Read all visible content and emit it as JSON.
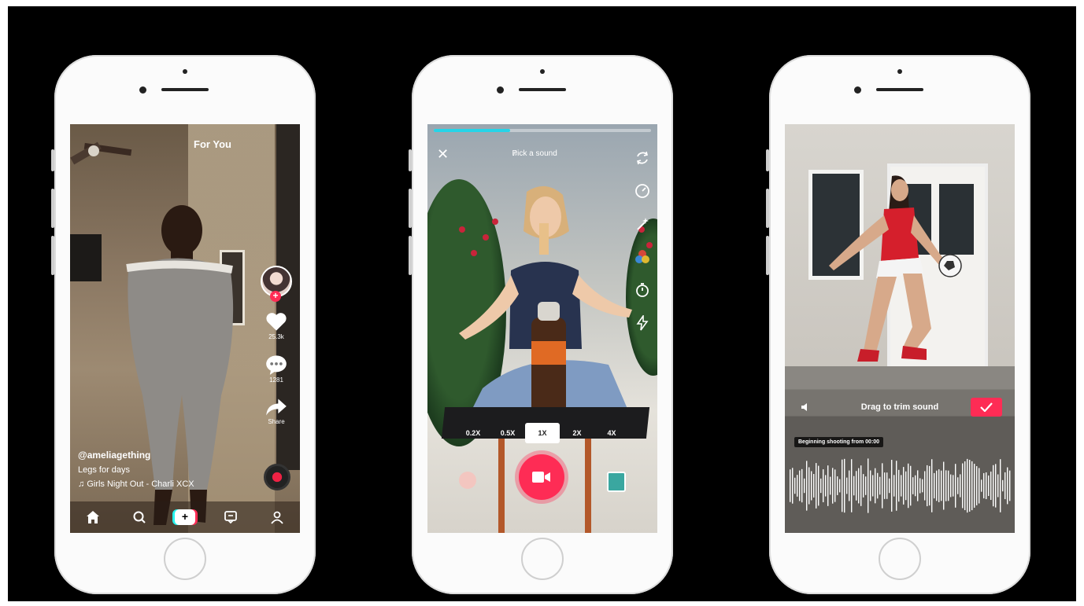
{
  "feed": {
    "header_tab": "For You",
    "like_count": "25.3k",
    "comment_count": "1281",
    "share_label": "Share",
    "username": "@ameliagething",
    "description": "Legs for days",
    "sound": "Girls Night Out - Charli XCX",
    "create_symbol": "+"
  },
  "camera": {
    "close_symbol": "✕",
    "sound_picker": "Pick a sound",
    "progress": 0.35,
    "speeds": [
      "0.2X",
      "0.5X",
      "1X",
      "2X",
      "4X"
    ],
    "selected_speed": "1X"
  },
  "trim": {
    "label": "Drag to trim sound",
    "beginning_note": "Beginning shooting from 00:00"
  },
  "colors": {
    "record_red": "#fe2c55",
    "cyan_accent": "#25f4ee",
    "progress_fill": "#25d4e8"
  }
}
